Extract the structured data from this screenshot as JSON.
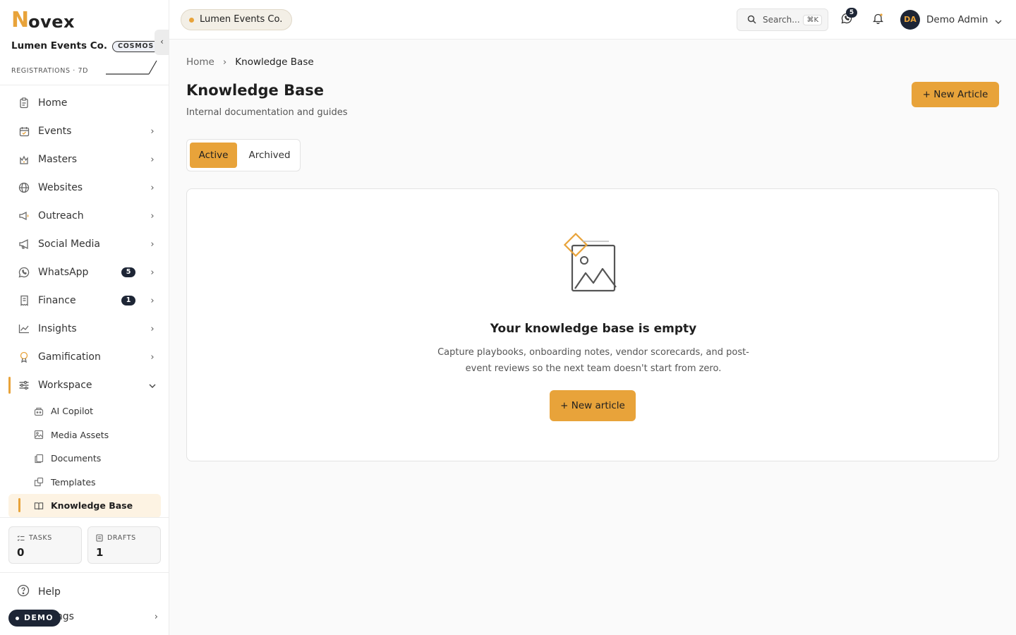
{
  "brand": {
    "logo_first": "N",
    "logo_rest": "ovex",
    "accent": "#e8a33a",
    "dark": "#1d2535"
  },
  "sidebar": {
    "org_name": "Lumen Events Co.",
    "org_badge": "COSMOS",
    "collapse_glyph": "‹",
    "sparkline_label": "REGISTRATIONS · 7D",
    "items": [
      {
        "label": "Home",
        "icon": "clipboard-icon"
      },
      {
        "label": "Events",
        "icon": "calendar-icon"
      },
      {
        "label": "Masters",
        "icon": "crown-icon"
      },
      {
        "label": "Websites",
        "icon": "globe-icon"
      },
      {
        "label": "Outreach",
        "icon": "megaphone-icon"
      },
      {
        "label": "Social Media",
        "icon": "megaphone-icon"
      },
      {
        "label": "WhatsApp",
        "icon": "whatsapp-icon",
        "count": "5"
      },
      {
        "label": "Finance",
        "icon": "receipt-icon",
        "count": "1"
      },
      {
        "label": "Insights",
        "icon": "line-chart-icon"
      },
      {
        "label": "Gamification",
        "icon": "trophy-icon"
      },
      {
        "label": "Workspace",
        "icon": "sliders-icon"
      }
    ],
    "workspace_sub": [
      {
        "label": "AI Copilot",
        "icon": "bot-icon"
      },
      {
        "label": "Media Assets",
        "icon": "image-icon"
      },
      {
        "label": "Documents",
        "icon": "files-icon"
      },
      {
        "label": "Templates",
        "icon": "template-icon"
      },
      {
        "label": "Knowledge Base",
        "icon": "book-icon"
      }
    ],
    "stats": [
      {
        "label": "TASKS",
        "value": "0"
      },
      {
        "label": "DRAFTS",
        "value": "1"
      }
    ],
    "help": "Help",
    "settings": "ings",
    "demo": "DEMO"
  },
  "topbar": {
    "org_chip": "Lumen Events Co.",
    "search_placeholder": "Search...",
    "search_shortcut": "⌘K",
    "messages_count": "5",
    "user_initials": "DA",
    "user_name": "Demo Admin"
  },
  "main": {
    "breadcrumb": {
      "home": "Home",
      "separator": "›",
      "current": "Knowledge Base"
    },
    "title": "Knowledge Base",
    "subtitle": "Internal documentation and guides",
    "new_button": "+ New Article",
    "tabs": [
      "Active",
      "Archived"
    ],
    "empty": {
      "title": "Your knowledge base is empty",
      "description": "Capture playbooks, onboarding notes, vendor scorecards, and post-event reviews so the next team doesn't start from zero.",
      "button": "+ New article"
    }
  }
}
